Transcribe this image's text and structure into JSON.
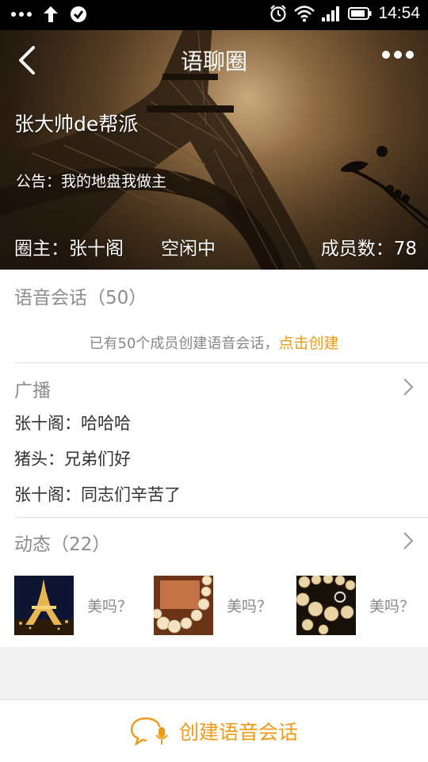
{
  "status_bar": {
    "time": "14:54",
    "left_icons": [
      "more-dots-icon",
      "upload-arrow-icon",
      "check-circle-icon"
    ],
    "right_icons": [
      "alarm-icon",
      "wifi-icon",
      "signal-icon",
      "battery-icon"
    ]
  },
  "header": {
    "title": "语聊圈",
    "group_name": "张大帅de帮派",
    "notice": "公告：我的地盘我做主",
    "owner": "圈主：张十阁",
    "status": "空闲中",
    "member_count": "成员数：78"
  },
  "voice_section": {
    "title": "语音会话（50）",
    "info_text": "已有50个成员创建语音会话，",
    "create_link": "点击创建"
  },
  "broadcast": {
    "title": "广播",
    "messages": [
      {
        "text": "张十阁：哈哈哈"
      },
      {
        "text": "猪头：兄弟们好"
      },
      {
        "text": "张十阁：同志们辛苦了"
      }
    ]
  },
  "moments": {
    "title": "动态（22）",
    "items": [
      {
        "caption": "美吗？",
        "image": "eiffel-tower-night-photo"
      },
      {
        "caption": "美吗？",
        "image": "pearl-necklace-photo"
      },
      {
        "caption": "美吗？",
        "image": "chanel-pearls-photo"
      }
    ]
  },
  "bottom_bar": {
    "create_label": "创建语音会话",
    "accent_color": "#f09a17"
  }
}
